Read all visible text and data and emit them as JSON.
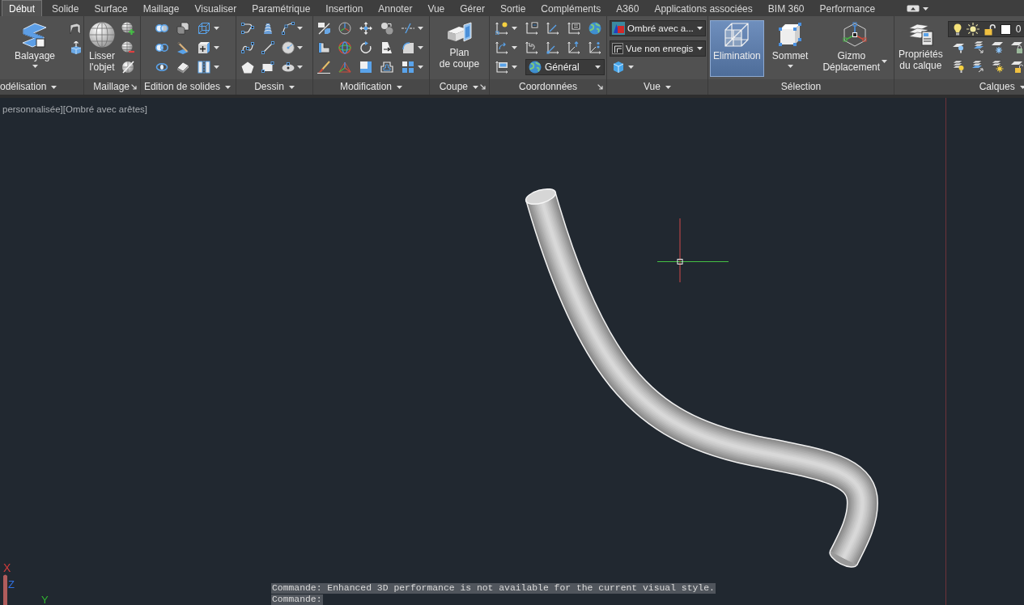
{
  "tabs": [
    {
      "label": "Début",
      "selected": true
    },
    {
      "label": "Solide",
      "selected": false
    },
    {
      "label": "Surface",
      "selected": false
    },
    {
      "label": "Maillage",
      "selected": false
    },
    {
      "label": "Visualiser",
      "selected": false
    },
    {
      "label": "Paramétrique",
      "selected": false
    },
    {
      "label": "Insertion",
      "selected": false
    },
    {
      "label": "Annoter",
      "selected": false
    },
    {
      "label": "Vue",
      "selected": false
    },
    {
      "label": "Gérer",
      "selected": false
    },
    {
      "label": "Sortie",
      "selected": false
    },
    {
      "label": "Compléments",
      "selected": false
    },
    {
      "label": "A360",
      "selected": false
    },
    {
      "label": "Applications associées",
      "selected": false
    },
    {
      "label": "BIM 360",
      "selected": false
    },
    {
      "label": "Performance",
      "selected": false
    }
  ],
  "ribbon": {
    "panels": [
      {
        "title": "odélisation",
        "menu": true,
        "launcher": false,
        "large": [
          {
            "label": "Balayage",
            "menu": true,
            "selected": false
          }
        ]
      },
      {
        "title": "Maillage",
        "menu": false,
        "launcher": true,
        "large": [
          {
            "label": "Lisser\nl'objet",
            "menu": false,
            "selected": false
          }
        ]
      },
      {
        "title": "Edition de solides",
        "menu": true,
        "launcher": false
      },
      {
        "title": "Dessin",
        "menu": true,
        "launcher": false
      },
      {
        "title": "Modification",
        "menu": true,
        "launcher": false
      },
      {
        "title": "Coupe",
        "menu": true,
        "launcher": true,
        "large": [
          {
            "label": "Plan\nde coupe",
            "menu": false,
            "selected": false
          }
        ]
      },
      {
        "title": "Coordonnées",
        "menu": false,
        "launcher": true,
        "dropdowns": [
          {
            "value": "Général"
          }
        ]
      },
      {
        "title": "Vue",
        "menu": true,
        "launcher": false,
        "dropdowns": [
          {
            "value": "Ombré avec a..."
          },
          {
            "value": "Vue non enregis"
          }
        ]
      },
      {
        "title": "Sélection",
        "menu": false,
        "launcher": false,
        "large": [
          {
            "label": "Elimination",
            "menu": false,
            "selected": true
          },
          {
            "label": "Sommet",
            "menu": true,
            "selected": false
          },
          {
            "label": "Gizmo\nDéplacement",
            "menu": true,
            "selected": false
          }
        ]
      },
      {
        "title": "Calques",
        "menu": true,
        "launcher": false,
        "large": [
          {
            "label": "Propriétés\ndu calque",
            "menu": false,
            "selected": false
          }
        ],
        "dropdowns": [
          {
            "value": "0"
          }
        ]
      }
    ]
  },
  "viewport": {
    "controls": "personnalisée][Ombré avec arêtes]",
    "ucs_axes": [
      {
        "label": "X",
        "color": "#d23c3c"
      },
      {
        "label": "Z",
        "color": "#3070e0"
      },
      {
        "label": "Y",
        "color": "#30b430"
      }
    ],
    "command_history": [
      "Commande: Enhanced 3D performance is not available for the current visual style.",
      "Commande:"
    ]
  }
}
